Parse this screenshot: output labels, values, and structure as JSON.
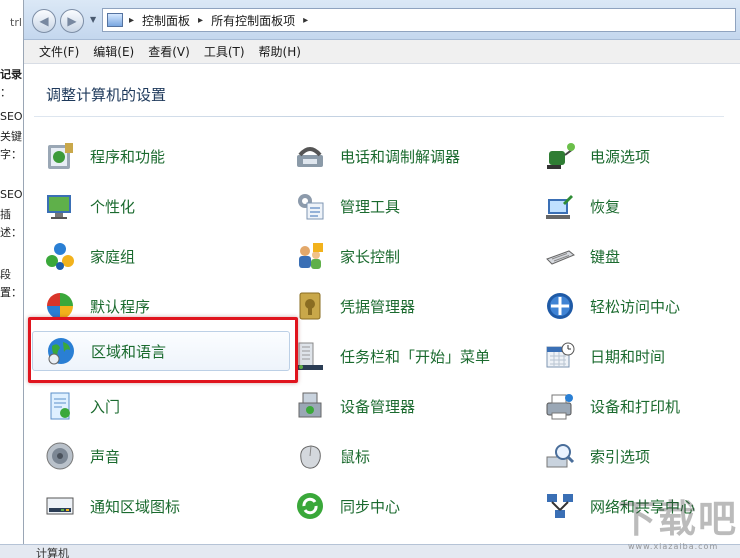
{
  "background_window": {
    "fragments": [
      "trl+",
      "记录",
      "：",
      "SEO",
      "关键",
      "字：",
      "SEO",
      "插",
      "述：",
      "段",
      "置："
    ]
  },
  "address": {
    "crumbs": [
      "控制面板",
      "所有控制面板项"
    ]
  },
  "menubar": {
    "items": [
      "文件(F)",
      "编辑(E)",
      "查看(V)",
      "工具(T)",
      "帮助(H)"
    ]
  },
  "page_title": "调整计算机的设置",
  "items": [
    {
      "label": "程序和功能",
      "icon": "programs-features-icon"
    },
    {
      "label": "电话和调制解调器",
      "icon": "phone-modem-icon"
    },
    {
      "label": "电源选项",
      "icon": "power-options-icon"
    },
    {
      "label": "个性化",
      "icon": "personalization-icon"
    },
    {
      "label": "管理工具",
      "icon": "admin-tools-icon"
    },
    {
      "label": "恢复",
      "icon": "recovery-icon"
    },
    {
      "label": "家庭组",
      "icon": "homegroup-icon"
    },
    {
      "label": "家长控制",
      "icon": "parental-controls-icon"
    },
    {
      "label": "键盘",
      "icon": "keyboard-icon"
    },
    {
      "label": "默认程序",
      "icon": "default-programs-icon"
    },
    {
      "label": "凭据管理器",
      "icon": "credential-manager-icon"
    },
    {
      "label": "轻松访问中心",
      "icon": "ease-of-access-icon"
    },
    {
      "label": "区域和语言",
      "icon": "region-language-icon"
    },
    {
      "label": "任务栏和「开始」菜单",
      "icon": "taskbar-start-icon"
    },
    {
      "label": "日期和时间",
      "icon": "date-time-icon"
    },
    {
      "label": "入门",
      "icon": "getting-started-icon"
    },
    {
      "label": "设备管理器",
      "icon": "device-manager-icon"
    },
    {
      "label": "设备和打印机",
      "icon": "devices-printers-icon"
    },
    {
      "label": "声音",
      "icon": "sound-icon"
    },
    {
      "label": "鼠标",
      "icon": "mouse-icon"
    },
    {
      "label": "索引选项",
      "icon": "indexing-icon"
    },
    {
      "label": "通知区域图标",
      "icon": "notification-area-icon"
    },
    {
      "label": "同步中心",
      "icon": "sync-center-icon"
    },
    {
      "label": "网络和共享中心",
      "icon": "network-sharing-icon"
    }
  ],
  "statusbar": {
    "text": "计算机"
  },
  "watermark": {
    "text": "下载吧",
    "url": "www.xiazaiba.com"
  },
  "colors": {
    "link_green": "#1a6a2e",
    "title_blue": "#1e395b",
    "highlight_red": "#e0141e"
  }
}
